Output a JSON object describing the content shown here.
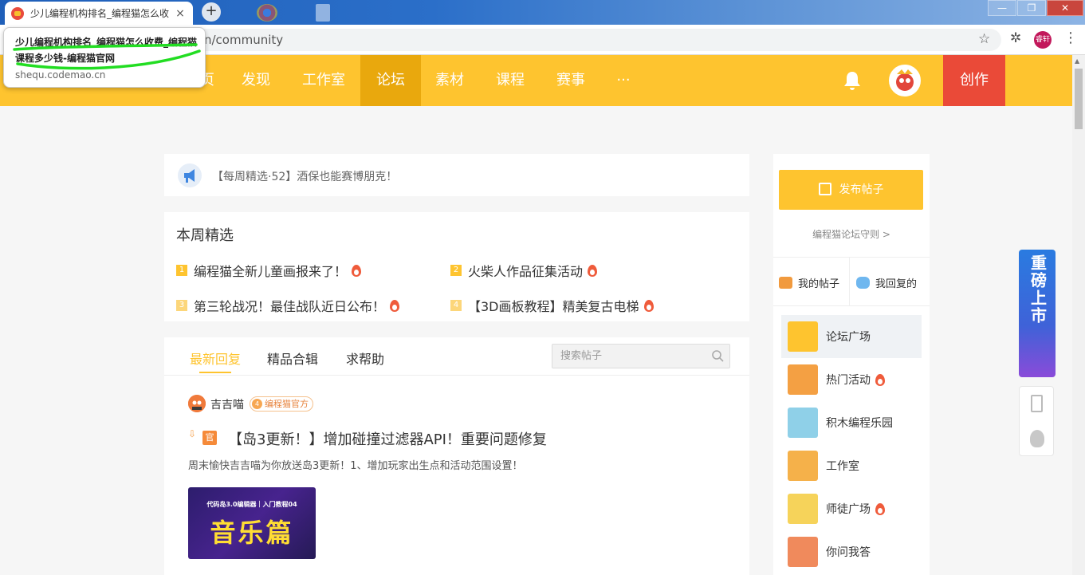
{
  "browser": {
    "tab_title": "少儿编程机构排名_编程猫怎么收",
    "tab_close": "×",
    "new_tab": "+",
    "url_visible": "n/community",
    "profile_label": "睿轩",
    "tooltip_title": "少儿编程机构排名_编程猫怎么收费_编程猫课程多少钱-编程猫官网",
    "tooltip_url": "shequ.codemao.cn",
    "window_buttons": [
      "—",
      "❐",
      "✕"
    ],
    "annotation_color": "#22dd22"
  },
  "nav": {
    "items": [
      "页",
      "发现",
      "工作室",
      "论坛",
      "素材",
      "课程",
      "赛事",
      "···"
    ],
    "active": "论坛",
    "create_label": "创作",
    "bg_color": "#fec42f"
  },
  "notice": {
    "text": "【每周精选·52】酒保也能赛博朋克！"
  },
  "weekly": {
    "title": "本周精选",
    "items": [
      {
        "rank": "1",
        "text": "编程猫全新儿童画报来了！"
      },
      {
        "rank": "2",
        "text": "火柴人作品征集活动"
      },
      {
        "rank": "3",
        "text": "第三轮战况！最佳战队近日公布！"
      },
      {
        "rank": "4",
        "text": "【3D画板教程】精美复古电梯"
      }
    ]
  },
  "posts": {
    "tabs": [
      "最新回复",
      "精品合辑",
      "求帮助"
    ],
    "active_tab": "最新回复",
    "search_placeholder": "搜索帖子",
    "first_post": {
      "author": "吉吉喵",
      "level": "4",
      "badge": "编程猫官方",
      "official_tag": "官",
      "title": "【岛3更新！】增加碰撞过滤器API！重要问题修复",
      "summary": "周末愉快吉吉喵为你放送岛3更新！1、增加玩家出生点和活动范围设置！",
      "thumb_caption": "代码岛3.0编辑器｜入门教程04",
      "thumb_big": "音乐篇"
    }
  },
  "sidebar": {
    "post_button": "发布帖子",
    "rules_link": "编程猫论坛守则 >",
    "my_posts": "我的帖子",
    "my_replies": "我回复的",
    "sections": [
      {
        "label": "论坛广场",
        "hot": false,
        "active": true
      },
      {
        "label": "热门活动",
        "hot": true,
        "active": false
      },
      {
        "label": "积木编程乐园",
        "hot": false,
        "active": false
      },
      {
        "label": "工作室",
        "hot": false,
        "active": false
      },
      {
        "label": "师徒广场",
        "hot": true,
        "active": false
      },
      {
        "label": "你问我答",
        "hot": false,
        "active": false
      }
    ]
  },
  "float_ad": {
    "text": "重磅上市"
  }
}
